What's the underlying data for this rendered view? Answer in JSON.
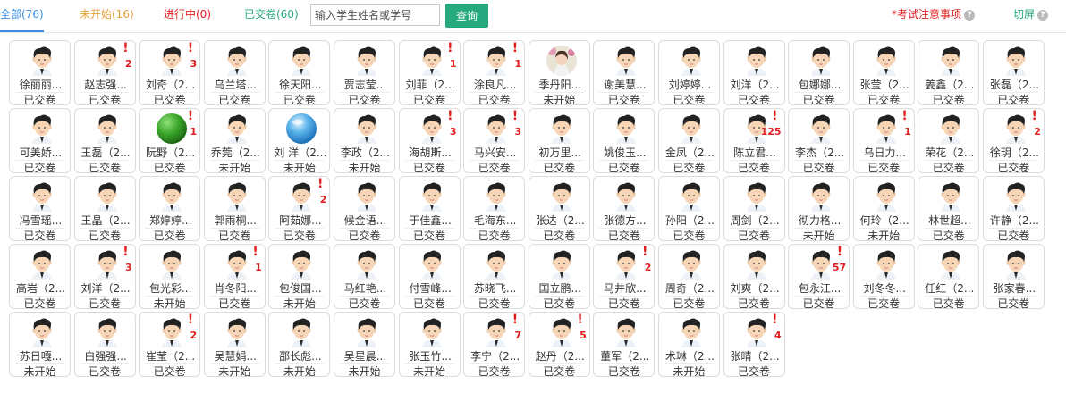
{
  "tabs": [
    {
      "label": "全部(76)",
      "color": "#3a8ee6",
      "active": true
    },
    {
      "label": "未开始(16)",
      "color": "#e6a23c",
      "active": false
    },
    {
      "label": "进行中(0)",
      "color": "#e02020",
      "active": false
    },
    {
      "label": "已交卷(60)",
      "color": "#26a97e",
      "active": false
    }
  ],
  "search": {
    "placeholder": "输入学生姓名或学号",
    "button": "查询"
  },
  "notice": {
    "label": "*考试注意事项",
    "icon": "question-icon"
  },
  "fullscreen": {
    "label": "切屏",
    "icon": "question-icon"
  },
  "colors": {
    "notice": "#e02020",
    "fullscreen": "#26a97e",
    "alert": "#e02020"
  },
  "students": [
    {
      "name": "徐丽丽...",
      "status": "已交卷",
      "alert": ""
    },
    {
      "name": "赵志强...",
      "status": "已交卷",
      "alert": "2"
    },
    {
      "name": "刘奇（2...",
      "status": "已交卷",
      "alert": "3"
    },
    {
      "name": "乌兰塔...",
      "status": "已交卷",
      "alert": ""
    },
    {
      "name": "徐天阳...",
      "status": "已交卷",
      "alert": ""
    },
    {
      "name": "贾志莹...",
      "status": "已交卷",
      "alert": ""
    },
    {
      "name": "刘菲（2...",
      "status": "已交卷",
      "alert": "1"
    },
    {
      "name": "涂良凡...",
      "status": "已交卷",
      "alert": "1"
    },
    {
      "name": "季丹阳...",
      "status": "未开始",
      "alert": "",
      "avatar": "photo"
    },
    {
      "name": "谢美慧...",
      "status": "已交卷",
      "alert": ""
    },
    {
      "name": "刘婷婷...",
      "status": "已交卷",
      "alert": ""
    },
    {
      "name": "刘洋（2...",
      "status": "已交卷",
      "alert": ""
    },
    {
      "name": "包娜娜...",
      "status": "已交卷",
      "alert": ""
    },
    {
      "name": "张莹（2...",
      "status": "已交卷",
      "alert": ""
    },
    {
      "name": "姜鑫（2...",
      "status": "已交卷",
      "alert": ""
    },
    {
      "name": "张磊（2...",
      "status": "已交卷",
      "alert": ""
    },
    {
      "name": "可美娇...",
      "status": "已交卷",
      "alert": ""
    },
    {
      "name": "王磊（2...",
      "status": "已交卷",
      "alert": ""
    },
    {
      "name": "阮野（2...",
      "status": "已交卷",
      "alert": "1",
      "avatar": "green-ball"
    },
    {
      "name": "乔莞（2...",
      "status": "未开始",
      "alert": ""
    },
    {
      "name": "刘 洋（2...",
      "status": "未开始",
      "alert": "",
      "avatar": "blue-ball"
    },
    {
      "name": "李政（2...",
      "status": "未开始",
      "alert": ""
    },
    {
      "name": "海胡斯...",
      "status": "已交卷",
      "alert": "3"
    },
    {
      "name": "马兴安...",
      "status": "已交卷",
      "alert": "3"
    },
    {
      "name": "初万里...",
      "status": "已交卷",
      "alert": ""
    },
    {
      "name": "姚俊玉...",
      "status": "已交卷",
      "alert": ""
    },
    {
      "name": "金凤（2...",
      "status": "已交卷",
      "alert": ""
    },
    {
      "name": "陈立君...",
      "status": "已交卷",
      "alert": "125"
    },
    {
      "name": "李杰（2...",
      "status": "已交卷",
      "alert": ""
    },
    {
      "name": "乌日力...",
      "status": "已交卷",
      "alert": "1"
    },
    {
      "name": "荣花（2...",
      "status": "已交卷",
      "alert": ""
    },
    {
      "name": "徐玥（2...",
      "status": "已交卷",
      "alert": "2"
    },
    {
      "name": "冯雪瑶...",
      "status": "已交卷",
      "alert": ""
    },
    {
      "name": "王晶（2...",
      "status": "已交卷",
      "alert": ""
    },
    {
      "name": "郑婷婷...",
      "status": "已交卷",
      "alert": ""
    },
    {
      "name": "郭雨桐...",
      "status": "已交卷",
      "alert": ""
    },
    {
      "name": "阿茹娜...",
      "status": "已交卷",
      "alert": "2"
    },
    {
      "name": "候金语...",
      "status": "已交卷",
      "alert": ""
    },
    {
      "name": "于佳鑫...",
      "status": "已交卷",
      "alert": ""
    },
    {
      "name": "毛海东...",
      "status": "已交卷",
      "alert": ""
    },
    {
      "name": "张达（2...",
      "status": "已交卷",
      "alert": ""
    },
    {
      "name": "张德方...",
      "status": "已交卷",
      "alert": ""
    },
    {
      "name": "孙阳（2...",
      "status": "已交卷",
      "alert": ""
    },
    {
      "name": "周剑（2...",
      "status": "已交卷",
      "alert": ""
    },
    {
      "name": "彻力格...",
      "status": "未开始",
      "alert": ""
    },
    {
      "name": "何玲（2...",
      "status": "未开始",
      "alert": ""
    },
    {
      "name": "林世超...",
      "status": "已交卷",
      "alert": ""
    },
    {
      "name": "许静（2...",
      "status": "已交卷",
      "alert": ""
    },
    {
      "name": "高岩（2...",
      "status": "已交卷",
      "alert": ""
    },
    {
      "name": "刘洋（2...",
      "status": "已交卷",
      "alert": "3"
    },
    {
      "name": "包光彩...",
      "status": "未开始",
      "alert": ""
    },
    {
      "name": "肖冬阳...",
      "status": "已交卷",
      "alert": "1"
    },
    {
      "name": "包俊国...",
      "status": "未开始",
      "alert": ""
    },
    {
      "name": "马红艳...",
      "status": "已交卷",
      "alert": ""
    },
    {
      "name": "付雪峰...",
      "status": "已交卷",
      "alert": ""
    },
    {
      "name": "苏晓飞...",
      "status": "已交卷",
      "alert": ""
    },
    {
      "name": "国立鹏...",
      "status": "已交卷",
      "alert": ""
    },
    {
      "name": "马井欣...",
      "status": "已交卷",
      "alert": "2"
    },
    {
      "name": "周奇（2...",
      "status": "已交卷",
      "alert": ""
    },
    {
      "name": "刘爽（2...",
      "status": "已交卷",
      "alert": ""
    },
    {
      "name": "包永江...",
      "status": "已交卷",
      "alert": "57"
    },
    {
      "name": "刘冬冬...",
      "status": "已交卷",
      "alert": ""
    },
    {
      "name": "任红（2...",
      "status": "已交卷",
      "alert": ""
    },
    {
      "name": "张家春...",
      "status": "已交卷",
      "alert": ""
    },
    {
      "name": "苏日嘎...",
      "status": "未开始",
      "alert": ""
    },
    {
      "name": "白强强...",
      "status": "已交卷",
      "alert": ""
    },
    {
      "name": "崔莹（2...",
      "status": "已交卷",
      "alert": "2"
    },
    {
      "name": "吴慧娟...",
      "status": "未开始",
      "alert": ""
    },
    {
      "name": "邵长彪...",
      "status": "未开始",
      "alert": ""
    },
    {
      "name": "吴星晨...",
      "status": "未开始",
      "alert": ""
    },
    {
      "name": "张玉竹...",
      "status": "未开始",
      "alert": ""
    },
    {
      "name": "李宁（2...",
      "status": "已交卷",
      "alert": "7"
    },
    {
      "name": "赵丹（2...",
      "status": "已交卷",
      "alert": "5"
    },
    {
      "name": "董军（2...",
      "status": "已交卷",
      "alert": ""
    },
    {
      "name": "术琳（2...",
      "status": "未开始",
      "alert": ""
    },
    {
      "name": "张晴（2...",
      "status": "已交卷",
      "alert": "4"
    }
  ]
}
